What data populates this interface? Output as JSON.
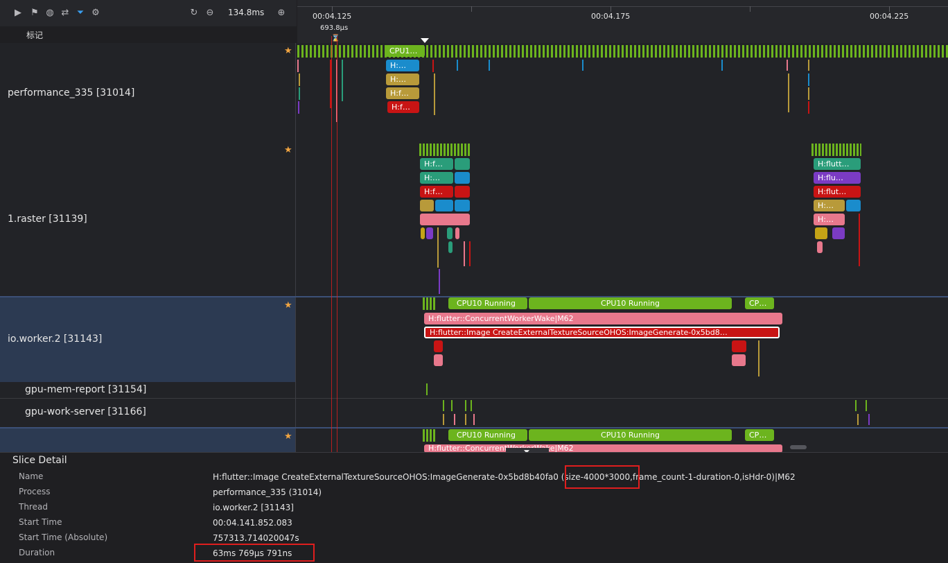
{
  "toolbar": {
    "icons": [
      "play-icon",
      "flag-icon",
      "globe-icon",
      "shuffle-icon",
      "filter-icon",
      "settings-icon"
    ],
    "zoom_out_icon": "reset-icon",
    "zoom_value": "134.8ms"
  },
  "marker_row": {
    "label": "标记",
    "cursor_value": "693.8μs"
  },
  "ruler": {
    "ticks": [
      "00:04.125",
      "00:04.175",
      "00:04.225"
    ]
  },
  "lanes": [
    {
      "title": "performance_335 [31014]",
      "starred": true,
      "slices": [
        "CPU1…",
        "H:…",
        "H:…",
        "H:f…",
        "H:f…"
      ]
    },
    {
      "title": "1.raster [31139]",
      "starred": true,
      "slices": [
        "H:f…",
        "H:…",
        "H:f…",
        "H:flutt…",
        "H:flu…",
        "H:flut…",
        "H:…",
        "H:…"
      ]
    },
    {
      "title": "io.worker.2 [31143]",
      "starred": true,
      "slices": [
        "CPU10 Running",
        "CPU10 Running",
        "CP…",
        "H:flutter::ConcurrentWorkerWake|M62",
        "H:flutter::Image CreateExternalTextureSourceOHOS:ImageGenerate-0x5bd8…"
      ]
    },
    {
      "title": "gpu-mem-report [31154]",
      "starred": false
    },
    {
      "title": "gpu-work-server [31166]",
      "starred": false
    },
    {
      "title": "",
      "starred": true,
      "slices": [
        "CPU10 Running",
        "CPU10 Running",
        "CP…",
        "H:flutter::ConcurrentWorkerWake|M62"
      ]
    }
  ],
  "slice_detail": {
    "title": "Slice Detail",
    "rows": [
      {
        "key": "Name",
        "value": "H:flutter::Image CreateExternalTextureSourceOHOS:ImageGenerate-0x5bd8b40fa0 (size-4000*3000,frame_count-1-duration-0,isHdr-0)|M62"
      },
      {
        "key": "Process",
        "value": "performance_335 (31014)"
      },
      {
        "key": "Thread",
        "value": "io.worker.2 [31143]"
      },
      {
        "key": "Start Time",
        "value": "00:04.141.852.083"
      },
      {
        "key": "Start Time (Absolute)",
        "value": "757313.714020047s"
      },
      {
        "key": "Duration",
        "value": "63ms 769μs 791ns"
      }
    ]
  },
  "colors": {
    "running": "#6cb41e",
    "teal": "#2a9d7a",
    "blue": "#1a8ccc",
    "gold": "#b89a3a",
    "red": "#c81414",
    "pink": "#e8788c",
    "purple": "#7b3bc4",
    "olive": "#c4a316",
    "highlight": "#e01e1e",
    "selected_lane": "#2c3a52"
  }
}
